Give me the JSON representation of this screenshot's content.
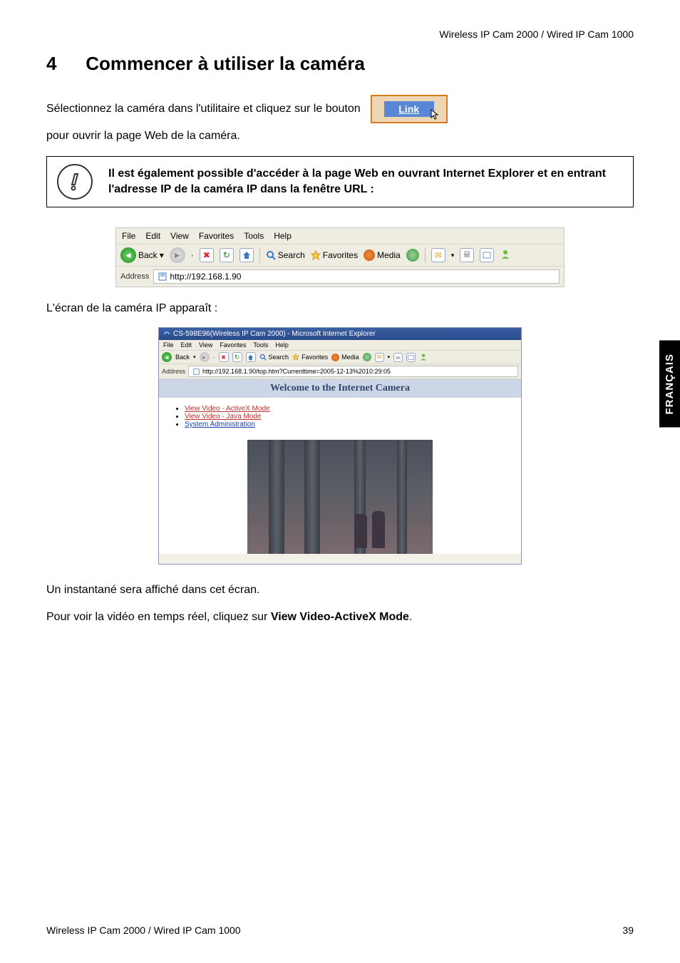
{
  "header": {
    "product_line": "Wireless IP Cam 2000 / Wired IP Cam 1000"
  },
  "section": {
    "number": "4",
    "title": "Commencer à utiliser la caméra"
  },
  "intro": {
    "before_btn": "Sélectionnez la caméra dans l'utilitaire et cliquez sur le bouton",
    "btn_label": "Link",
    "after_btn": "pour ouvrir la page Web de la caméra."
  },
  "note": {
    "text": "Il est également possible d'accéder à la page Web en ouvrant Internet Explorer et en entrant l'adresse IP de la caméra IP dans la fenêtre URL :"
  },
  "ie_toolbar": {
    "menu": [
      "File",
      "Edit",
      "View",
      "Favorites",
      "Tools",
      "Help"
    ],
    "back": "Back",
    "search": "Search",
    "favorites": "Favorites",
    "media": "Media",
    "address_label": "Address",
    "address_value": "http://192.168.1.90"
  },
  "after_ie": "L'écran de la caméra IP apparaît :",
  "camera_page": {
    "window_title": "CS-598E96(Wireless IP Cam 2000) - Microsoft Internet Explorer",
    "menu": [
      "File",
      "Edit",
      "View",
      "Favorites",
      "Tools",
      "Help"
    ],
    "back": "Back",
    "search": "Search",
    "favorites": "Favorites",
    "media": "Media",
    "address_label": "Address",
    "address_value": "http://192.168.1.90/top.htm?Currenttime=2005-12-13%2010:29:05",
    "banner": "Welcome to the Internet Camera",
    "links": [
      "View Video - ActiveX Mode",
      "View Video - Java Mode",
      "System Administration"
    ]
  },
  "after_shot": "Un instantané sera affiché dans cet écran.",
  "realtime": {
    "prefix": "Pour voir la vidéo en temps réel, cliquez sur ",
    "bold": "View Video-ActiveX Mode",
    "suffix": "."
  },
  "side_tab": "FRANÇAIS",
  "footer": {
    "left": "Wireless IP Cam 2000 / Wired IP Cam 1000",
    "page": "39"
  }
}
